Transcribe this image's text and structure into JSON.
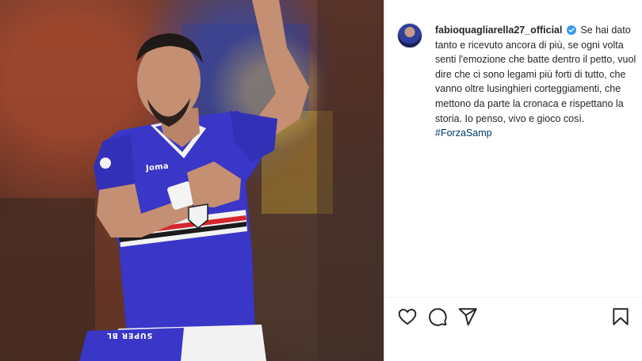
{
  "post": {
    "username": "fabioquagliarella27_official",
    "verified": true,
    "caption": "Se hai dato tanto e ricevuto ancora di più, se ogni volta senti l'emozione che batte dentro il petto, vuol dire che ci sono legami più forti di tutto, che vanno oltre lusinghieri corteggiamenti, che mettono da parte la cronaca e rispettano la storia. Io penso, vivo e gioco così.",
    "hashtag": "#ForzaSamp"
  },
  "photo": {
    "jersey_brand": "Joma",
    "shorts_text": "SUPER BL"
  },
  "icons": {
    "like": "heart-icon",
    "comment": "comment-icon",
    "share": "share-icon",
    "save": "bookmark-icon",
    "verified": "verified-badge-icon"
  },
  "colors": {
    "jersey": "#3a36c8",
    "verified": "#3897f0",
    "hashtag": "#00376b",
    "text": "#262626"
  }
}
